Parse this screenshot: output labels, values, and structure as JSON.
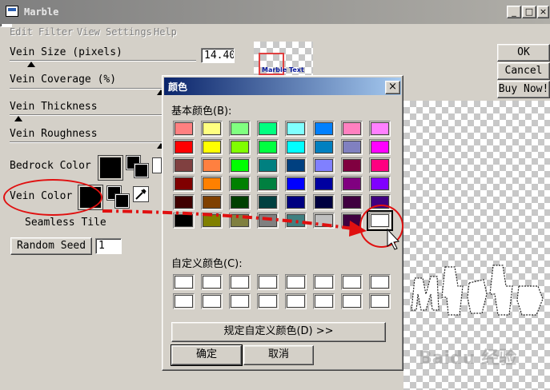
{
  "window": {
    "title": "Marble",
    "minimize": "_",
    "maximize": "□",
    "close": "×"
  },
  "menu": [
    "Edit",
    "Filter",
    "View",
    "Settings",
    "Help"
  ],
  "params": {
    "vein_size_label": "Vein Size (pixels)",
    "vein_size_value": "14.40",
    "vein_coverage_label": "Vein Coverage (%)",
    "vein_thickness_label": "Vein Thickness",
    "vein_roughness_label": "Vein Roughness",
    "bedrock_color_label": "Bedrock Color",
    "vein_color_label": "Vein Color",
    "seamless_tile_label": "Seamless Tile",
    "random_seed_button": "Random Seed",
    "random_seed_value": "1"
  },
  "preview": {
    "thumb_text": "Marble Text"
  },
  "right_buttons": {
    "ok": "OK",
    "cancel": "Cancel",
    "buy": "Buy Now!"
  },
  "color_dialog": {
    "title": "颜色",
    "basic_colors_label": "基本颜色(B):",
    "custom_colors_label": "自定义颜色(C):",
    "define_custom_button": "规定自定义颜色(D) >>",
    "ok_button": "确定",
    "cancel_button": "取消",
    "basic_colors": [
      [
        "#ff8080",
        "#ffff80",
        "#80ff80",
        "#00ff80",
        "#80ffff",
        "#0080ff",
        "#ff80c0",
        "#ff80ff"
      ],
      [
        "#ff0000",
        "#ffff00",
        "#80ff00",
        "#00ff40",
        "#00ffff",
        "#0080c0",
        "#8080c0",
        "#ff00ff"
      ],
      [
        "#804040",
        "#ff8040",
        "#00ff00",
        "#008080",
        "#004080",
        "#8080ff",
        "#800040",
        "#ff0080"
      ],
      [
        "#800000",
        "#ff8000",
        "#008000",
        "#008040",
        "#0000ff",
        "#0000a0",
        "#800080",
        "#8000ff"
      ],
      [
        "#400000",
        "#804000",
        "#004000",
        "#004040",
        "#000080",
        "#000040",
        "#400040",
        "#400080"
      ],
      [
        "#000000",
        "#808000",
        "#808040",
        "#808080",
        "#408080",
        "#c0c0c0",
        "#400040",
        "#ffffff"
      ]
    ],
    "custom_colors": [
      [
        "#ffffff",
        "#ffffff",
        "#ffffff",
        "#ffffff",
        "#ffffff",
        "#ffffff",
        "#ffffff",
        "#ffffff"
      ],
      [
        "#ffffff",
        "#ffffff",
        "#ffffff",
        "#ffffff",
        "#ffffff",
        "#ffffff",
        "#ffffff",
        "#ffffff"
      ]
    ],
    "selected_cell": "row 6, column 8"
  },
  "watermark": "Baidu 经验",
  "colors": {
    "annotation_red": "#e01010",
    "dialog_title": "#0a246a",
    "face": "#d4d0c8"
  }
}
